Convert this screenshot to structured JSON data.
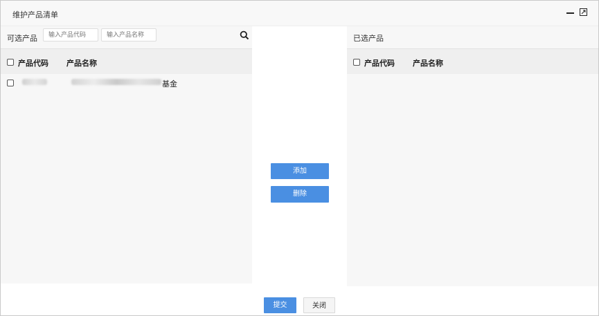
{
  "dialog": {
    "title": "维护产品清单"
  },
  "left_panel": {
    "label": "可选产品",
    "search_code_placeholder": "输入产品代码",
    "search_name_placeholder": "输入产品名称",
    "columns": [
      "产品代码",
      "产品名称"
    ],
    "rows": [
      {
        "code_visible": "",
        "name_visible": "基金"
      }
    ]
  },
  "right_panel": {
    "label": "已选产品",
    "columns": [
      "产品代码",
      "产品名称"
    ],
    "rows": []
  },
  "actions": {
    "add_label": "添加",
    "delete_label": "删除"
  },
  "footer": {
    "submit_label": "提交",
    "close_label": "关闭"
  },
  "colors": {
    "primary": "#4a8fe2",
    "panel_bg": "#f7f7f7",
    "header_bg": "#efefef"
  }
}
